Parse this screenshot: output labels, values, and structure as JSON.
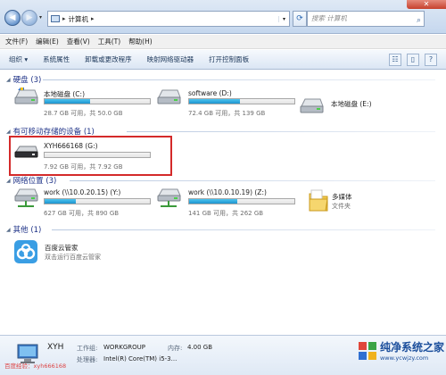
{
  "address": {
    "crumbs": [
      "计算机"
    ],
    "sep": "▸",
    "search_placeholder": "搜索 计算机"
  },
  "menu": [
    "文件(F)",
    "编辑(E)",
    "查看(V)",
    "工具(T)",
    "帮助(H)"
  ],
  "commands": [
    "组织 ▾",
    "系统属性",
    "卸载或更改程序",
    "映射网络驱动器",
    "打开控制面板"
  ],
  "groups": {
    "hdd": "硬盘 (3)",
    "removable": "有可移动存储的设备 (1)",
    "network": "网络位置 (3)",
    "other": "其他 (1)"
  },
  "drives": {
    "c": {
      "name": "本地磁盘 (C:)",
      "sub": "28.7 GB 可用，共 50.0 GB",
      "used_fraction": 0.43
    },
    "d": {
      "name": "software (D:)",
      "sub": "72.4 GB 可用，共 139 GB",
      "used_fraction": 0.48
    },
    "e": {
      "name": "本地磁盘 (E:)"
    },
    "g": {
      "name": "XYH666168 (G:)",
      "sub": "7.92 GB 可用，共 7.92 GB",
      "used_fraction": 0.0
    },
    "y": {
      "name": "work (\\\\10.0.20.15) (Y:)",
      "sub": "627 GB 可用，共 890 GB",
      "used_fraction": 0.3
    },
    "z": {
      "name": "work (\\\\10.0.10.19) (Z:)",
      "sub": "141 GB 可用，共 262 GB",
      "used_fraction": 0.46
    },
    "media": {
      "name": "多媒体",
      "sub": "文件夹"
    }
  },
  "other_item": {
    "name": "百度云管家",
    "sub": "双击运行百度云管家"
  },
  "details": {
    "title": "XYH",
    "workgroup_label": "工作组:",
    "workgroup": "WORKGROUP",
    "memory_label": "内存:",
    "memory": "4.00 GB",
    "cpu_label": "处理器:",
    "cpu": "Intel(R) Core(TM) i5-3..."
  },
  "watermark": {
    "left": "百度经验：xyh666168",
    "brand": "纯净系统之家",
    "url": "www.ycwjzy.com"
  },
  "colors": {
    "accent": "#1e3287",
    "bar_fill": "#26a0da",
    "highlight": "#d42a2a"
  }
}
